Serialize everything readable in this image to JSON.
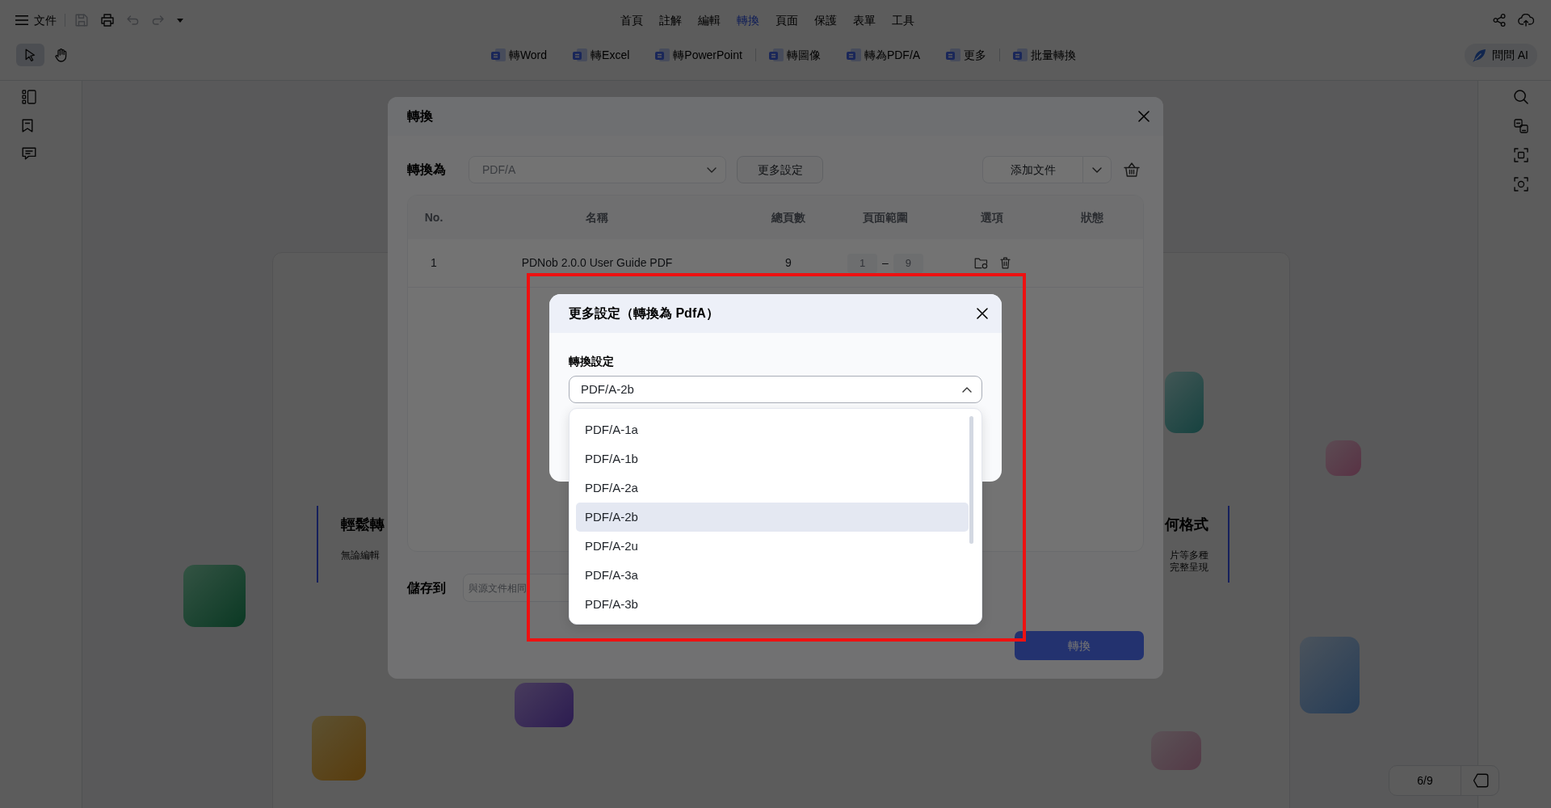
{
  "app": {
    "file_menu": "文件",
    "quick_actions": [
      {
        "disabled": true
      },
      {
        "disabled": false
      },
      {
        "disabled": true
      },
      {
        "disabled": true
      }
    ],
    "menu_tabs": [
      {
        "label": "首頁",
        "selected": false
      },
      {
        "label": "註解",
        "selected": false
      },
      {
        "label": "編輯",
        "selected": false
      },
      {
        "label": "轉換",
        "selected": true
      },
      {
        "label": "頁面",
        "selected": false
      },
      {
        "label": "保護",
        "selected": false
      },
      {
        "label": "表單",
        "selected": false
      },
      {
        "label": "工具",
        "selected": false
      }
    ],
    "tools": [
      {
        "selected": true
      },
      {
        "selected": false
      }
    ],
    "toolbar_groups": [
      {
        "items": [
          "轉Word",
          "轉Excel",
          "轉PowerPoint"
        ]
      },
      {
        "items": [
          "轉圖像",
          "轉為PDF/A",
          "更多"
        ]
      },
      {
        "items": [
          "批量轉換"
        ]
      }
    ],
    "ask_ai": "問問 AI",
    "document": {
      "left_heading": "輕鬆轉",
      "left_text": "無論編輯",
      "right_heading": "何格式",
      "right_lines": [
        "片等多種",
        "完整呈現"
      ]
    },
    "page_indicator": "6/9"
  },
  "convert_dialog": {
    "title": "轉換",
    "convert_to": {
      "label": "轉換為",
      "value": "PDF/A",
      "expanded": false
    },
    "more_settings_button": "更多設定",
    "add_files_button": "添加文件",
    "table": {
      "columns": [
        "No.",
        "名稱",
        "總頁數",
        "頁面範圍",
        "選項",
        "狀態"
      ],
      "rows": [
        {
          "no": "1",
          "name": "PDNob 2.0.0 User Guide PDF",
          "total_pages": "9",
          "range_from": "1",
          "range_separator": "–",
          "range_to": "9"
        }
      ]
    },
    "save_to": {
      "label": "儲存到",
      "value": "與源文件相同"
    },
    "convert_button": "轉換"
  },
  "settings_dialog": {
    "title": "更多設定（轉換為 PdfA）",
    "field_label": "轉換設定",
    "value": "PDF/A-2b",
    "expanded": true,
    "options": [
      {
        "label": "PDF/A-1a",
        "selected": false
      },
      {
        "label": "PDF/A-1b",
        "selected": false
      },
      {
        "label": "PDF/A-2a",
        "selected": false
      },
      {
        "label": "PDF/A-2b",
        "selected": true
      },
      {
        "label": "PDF/A-2u",
        "selected": false
      },
      {
        "label": "PDF/A-3a",
        "selected": false
      },
      {
        "label": "PDF/A-3b",
        "selected": false
      }
    ]
  }
}
